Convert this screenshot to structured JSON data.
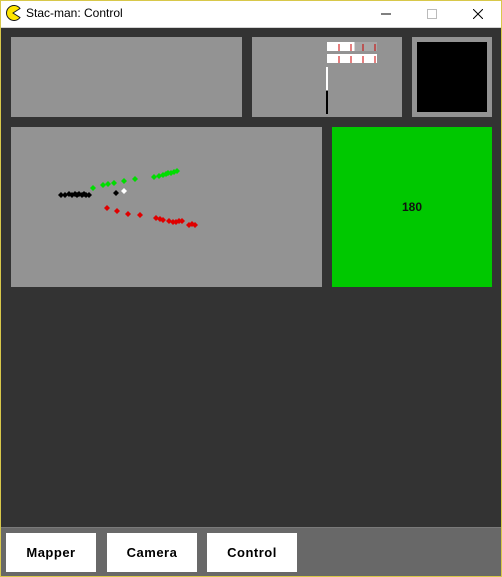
{
  "window": {
    "title": "Stac-man: Control",
    "app_icon": "pacman-icon",
    "controls": [
      "minimize-icon",
      "maximize-icon",
      "close-icon"
    ]
  },
  "colors": {
    "background": "#333333",
    "panel": "#939393",
    "heading_panel": "#00c800",
    "camera_screen": "#000000",
    "bottom_bar": "#686868",
    "series_black": "#000000",
    "series_green": "#00dd00",
    "series_red": "#e00000",
    "robot_marker": "#ffffff"
  },
  "heading": {
    "value": "180"
  },
  "sensor_bars": {
    "bars": [
      {
        "fill": 0.55,
        "color": "#ffffff"
      },
      {
        "fill": 1.0,
        "color": "#ffffff"
      }
    ],
    "vertical_level": 0.5,
    "tick_color": "#cc0000"
  },
  "navigation": {
    "mapper_label": "Mapper",
    "camera_label": "Camera",
    "control_label": "Control"
  }
}
